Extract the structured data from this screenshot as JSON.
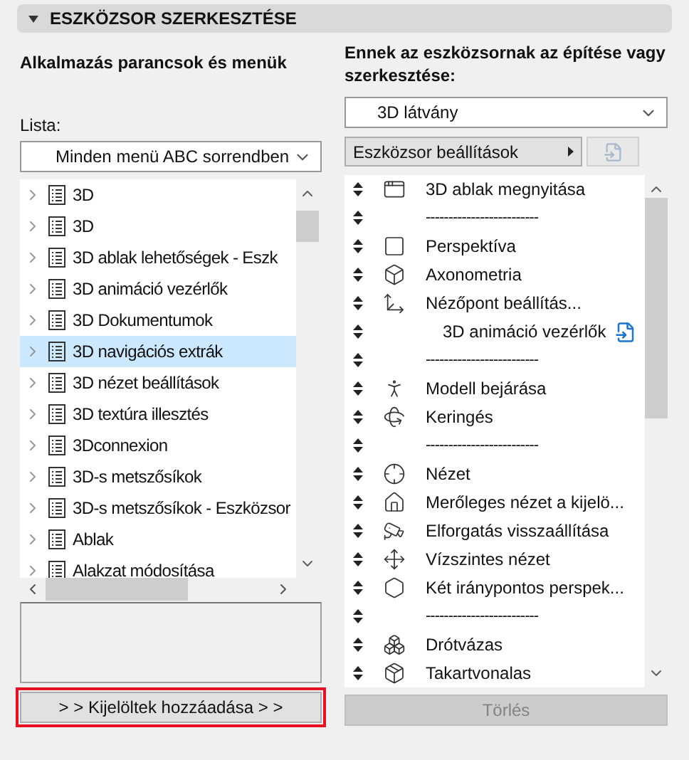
{
  "section": {
    "title": "ESZKÖZSOR SZERKESZTÉSE",
    "expanded": true
  },
  "left": {
    "heading": "Alkalmazás parancsok és menük",
    "list_label": "Lista:",
    "list_select": "Minden menü ABC sorrendben",
    "items": [
      {
        "label": "3D",
        "selected": false
      },
      {
        "label": "3D",
        "selected": false
      },
      {
        "label": "3D ablak lehetőségek - Eszk",
        "selected": false
      },
      {
        "label": "3D animáció vezérlők",
        "selected": false
      },
      {
        "label": "3D Dokumentumok",
        "selected": false
      },
      {
        "label": "3D navigációs extrák",
        "selected": true
      },
      {
        "label": "3D nézet beállítások",
        "selected": false
      },
      {
        "label": "3D textúra illesztés",
        "selected": false
      },
      {
        "label": "3Dconnexion",
        "selected": false
      },
      {
        "label": "3D-s metszősíkok",
        "selected": false
      },
      {
        "label": "3D-s metszősíkok - Eszközsor",
        "selected": false
      },
      {
        "label": "Ablak",
        "selected": false
      },
      {
        "label": "Alakzat módosítása",
        "selected": false
      }
    ],
    "add_button": "> > Kijelöltek hozzáadása > >"
  },
  "right": {
    "heading": "Ennek az eszközsornak az építése vagy szerkesztése:",
    "toolbar_select": "3D látvány",
    "settings_button": "Eszközsor beállítások",
    "items": [
      {
        "kind": "item",
        "label": "3D ablak megnyitása"
      },
      {
        "kind": "separator",
        "label": "-------------------------"
      },
      {
        "kind": "item",
        "label": "Perspektíva"
      },
      {
        "kind": "item",
        "label": "Axonometria"
      },
      {
        "kind": "item",
        "label": "Nézőpont beállítás..."
      },
      {
        "kind": "submenu",
        "label": "3D animáció vezérlők"
      },
      {
        "kind": "separator",
        "label": "-------------------------"
      },
      {
        "kind": "item",
        "label": "Modell bejárása"
      },
      {
        "kind": "item",
        "label": "Keringés"
      },
      {
        "kind": "separator",
        "label": "-------------------------"
      },
      {
        "kind": "item",
        "label": "Nézet"
      },
      {
        "kind": "item",
        "label": "Merőleges nézet a kijelö..."
      },
      {
        "kind": "item",
        "label": "Elforgatás visszaállítása"
      },
      {
        "kind": "item",
        "label": "Vízszintes nézet"
      },
      {
        "kind": "item",
        "label": "Két iránypontos perspek..."
      },
      {
        "kind": "separator",
        "label": "-------------------------"
      },
      {
        "kind": "item",
        "label": "Drótvázas"
      },
      {
        "kind": "item",
        "label": "Takartvonalas"
      }
    ],
    "delete_button": "Törlés",
    "delete_disabled": true
  }
}
